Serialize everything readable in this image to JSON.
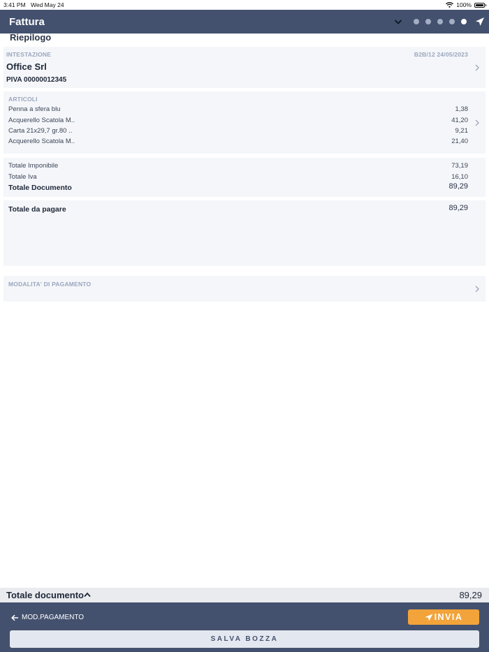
{
  "status_bar": {
    "time": "3:41 PM",
    "date": "Wed May 24",
    "battery": "100%"
  },
  "header": {
    "title": "Fattura",
    "steps": [
      {
        "active": false
      },
      {
        "active": false
      },
      {
        "active": false
      },
      {
        "active": false
      },
      {
        "active": true
      }
    ],
    "icons": {
      "dropdown": "chevron-down-icon",
      "send": "send-icon"
    }
  },
  "section_title": "Riepilogo",
  "intestazione": {
    "caption": "INTESTAZIONE",
    "doc_ref": "B2B/12 24/05/2023",
    "company": "Office Srl",
    "vat": "PIVA 00000012345"
  },
  "articoli": {
    "caption": "ARTICOLI",
    "items": [
      {
        "name": "Penna a sfera blu",
        "amount": "1,38"
      },
      {
        "name": "Acquerello Scatola M..",
        "amount": "41,20"
      },
      {
        "name": "Carta 21x29,7 gr.80 ..",
        "amount": "9,21"
      },
      {
        "name": "Acquerello Scatola M..",
        "amount": "21,40"
      }
    ]
  },
  "totals": {
    "imponibile_label": "Totale Imponibile",
    "imponibile_value": "73,19",
    "iva_label": "Totale Iva",
    "iva_value": "16,10",
    "documento_label": "Totale Documento",
    "documento_value": "89,29"
  },
  "da_pagare": {
    "label": "Totale da pagare",
    "value": "89,29"
  },
  "pagamento": {
    "caption": "MODALITA' DI PAGAMENTO"
  },
  "bottom_total": {
    "label": "Totale documento",
    "value": "89,29"
  },
  "footer": {
    "back_label": "MOD.PAGAMENTO",
    "invia_label": "INVIA",
    "save_label": "SALVA BOZZA"
  },
  "colors": {
    "header_bg": "#44516e",
    "accent_orange": "#f2a33a",
    "caption": "#9aa6be",
    "card_bg": "#f4f6f9"
  }
}
